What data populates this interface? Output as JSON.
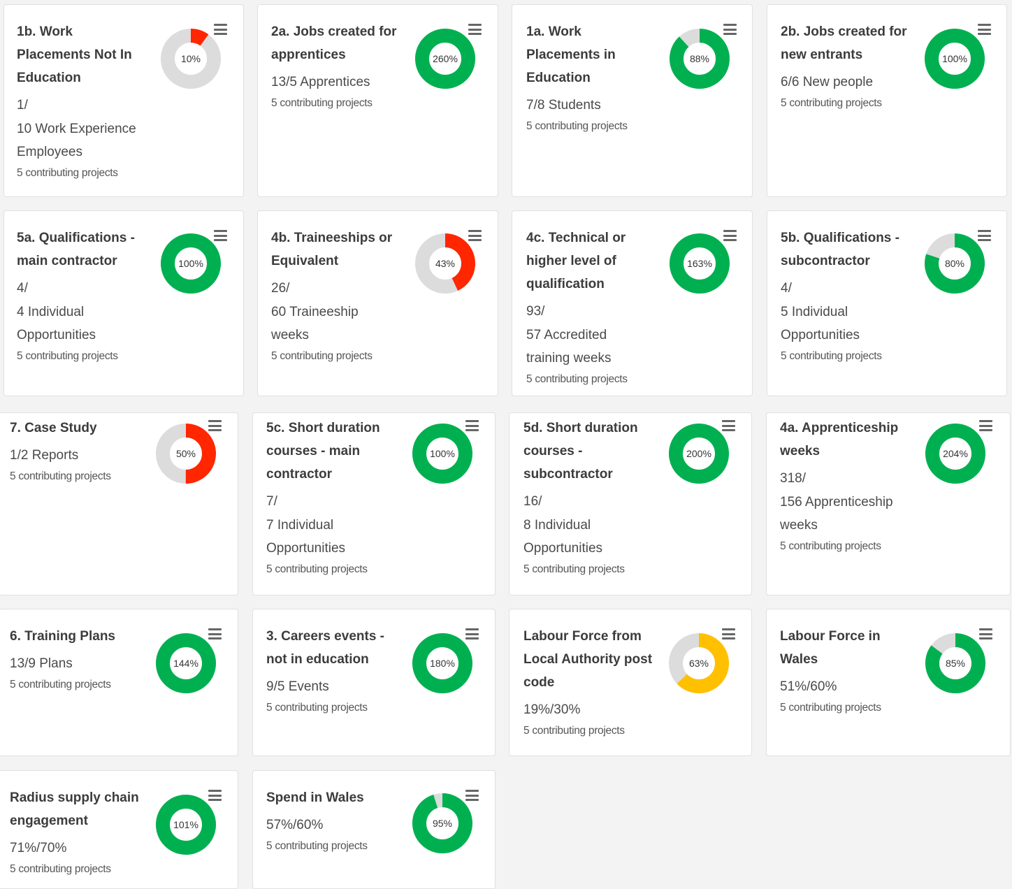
{
  "colors": {
    "green": "#00b050",
    "red": "#ff2600",
    "amber": "#ffc000",
    "track": "#dcdcdc"
  },
  "cards": [
    {
      "title": "1b. Work\nPlacements Not In\nEducation",
      "value": "1/\n10 Work Experience\nEmployees",
      "projects": "5 contributing projects",
      "percent_label": "10%",
      "percent": 10,
      "color": "red"
    },
    {
      "title": "2a. Jobs created for\napprentices",
      "value": "13/5 Apprentices",
      "projects": "5 contributing projects",
      "percent_label": "260%",
      "percent": 260,
      "color": "green"
    },
    {
      "title": "1a. Work\nPlacements in\nEducation",
      "value": "7/8 Students",
      "projects": "5 contributing projects",
      "percent_label": "88%",
      "percent": 88,
      "color": "green"
    },
    {
      "title": "2b. Jobs created for\nnew entrants",
      "value": "6/6 New people",
      "projects": "5 contributing projects",
      "percent_label": "100%",
      "percent": 100,
      "color": "green"
    },
    {
      "title": "5a. Qualifications -\nmain contractor",
      "value": "4/\n4 Individual\nOpportunities",
      "projects": "5 contributing projects",
      "percent_label": "100%",
      "percent": 100,
      "color": "green"
    },
    {
      "title": "4b. Traineeships or\nEquivalent",
      "value": "26/\n60 Traineeship\nweeks",
      "projects": "5 contributing projects",
      "percent_label": "43%",
      "percent": 43,
      "color": "red"
    },
    {
      "title": "4c. Technical or\nhigher level of\nqualification",
      "value": "93/\n57 Accredited\ntraining weeks",
      "projects": "5 contributing projects",
      "percent_label": "163%",
      "percent": 163,
      "color": "green"
    },
    {
      "title": "5b. Qualifications -\nsubcontractor",
      "value": "4/\n5 Individual\nOpportunities",
      "projects": "5 contributing projects",
      "percent_label": "80%",
      "percent": 80,
      "color": "green"
    },
    {
      "title": "7. Case Study",
      "value": "1/2 Reports",
      "projects": "5 contributing projects",
      "percent_label": "50%",
      "percent": 50,
      "color": "red"
    },
    {
      "title": "5c. Short duration\ncourses - main\ncontractor",
      "value": "7/\n7 Individual\nOpportunities",
      "projects": "5 contributing projects",
      "percent_label": "100%",
      "percent": 100,
      "color": "green"
    },
    {
      "title": "5d. Short duration\ncourses -\nsubcontractor",
      "value": "16/\n8 Individual\nOpportunities",
      "projects": "5 contributing projects",
      "percent_label": "200%",
      "percent": 200,
      "color": "green"
    },
    {
      "title": "4a. Apprenticeship\nweeks",
      "value": "318/\n156 Apprenticeship\nweeks",
      "projects": "5 contributing projects",
      "percent_label": "204%",
      "percent": 204,
      "color": "green"
    },
    {
      "title": "6. Training Plans",
      "value": "13/9 Plans",
      "projects": "5 contributing projects",
      "percent_label": "144%",
      "percent": 144,
      "color": "green"
    },
    {
      "title": "3. Careers events -\nnot in education",
      "value": "9/5 Events",
      "projects": "5 contributing projects",
      "percent_label": "180%",
      "percent": 180,
      "color": "green"
    },
    {
      "title": "Labour Force from\nLocal Authority post\ncode",
      "value": "19%/30%",
      "projects": "5 contributing projects",
      "percent_label": "63%",
      "percent": 63,
      "color": "amber"
    },
    {
      "title": "Labour Force in\nWales",
      "value": "51%/60%",
      "projects": "5 contributing projects",
      "percent_label": "85%",
      "percent": 85,
      "color": "green"
    },
    {
      "title": "Radius supply chain\nengagement",
      "value": "71%/70%",
      "projects": "5 contributing projects",
      "percent_label": "101%",
      "percent": 101,
      "color": "green"
    },
    {
      "title": "Spend in Wales",
      "value": "57%/60%",
      "projects": "5 contributing projects",
      "percent_label": "95%",
      "percent": 95,
      "color": "green"
    }
  ]
}
